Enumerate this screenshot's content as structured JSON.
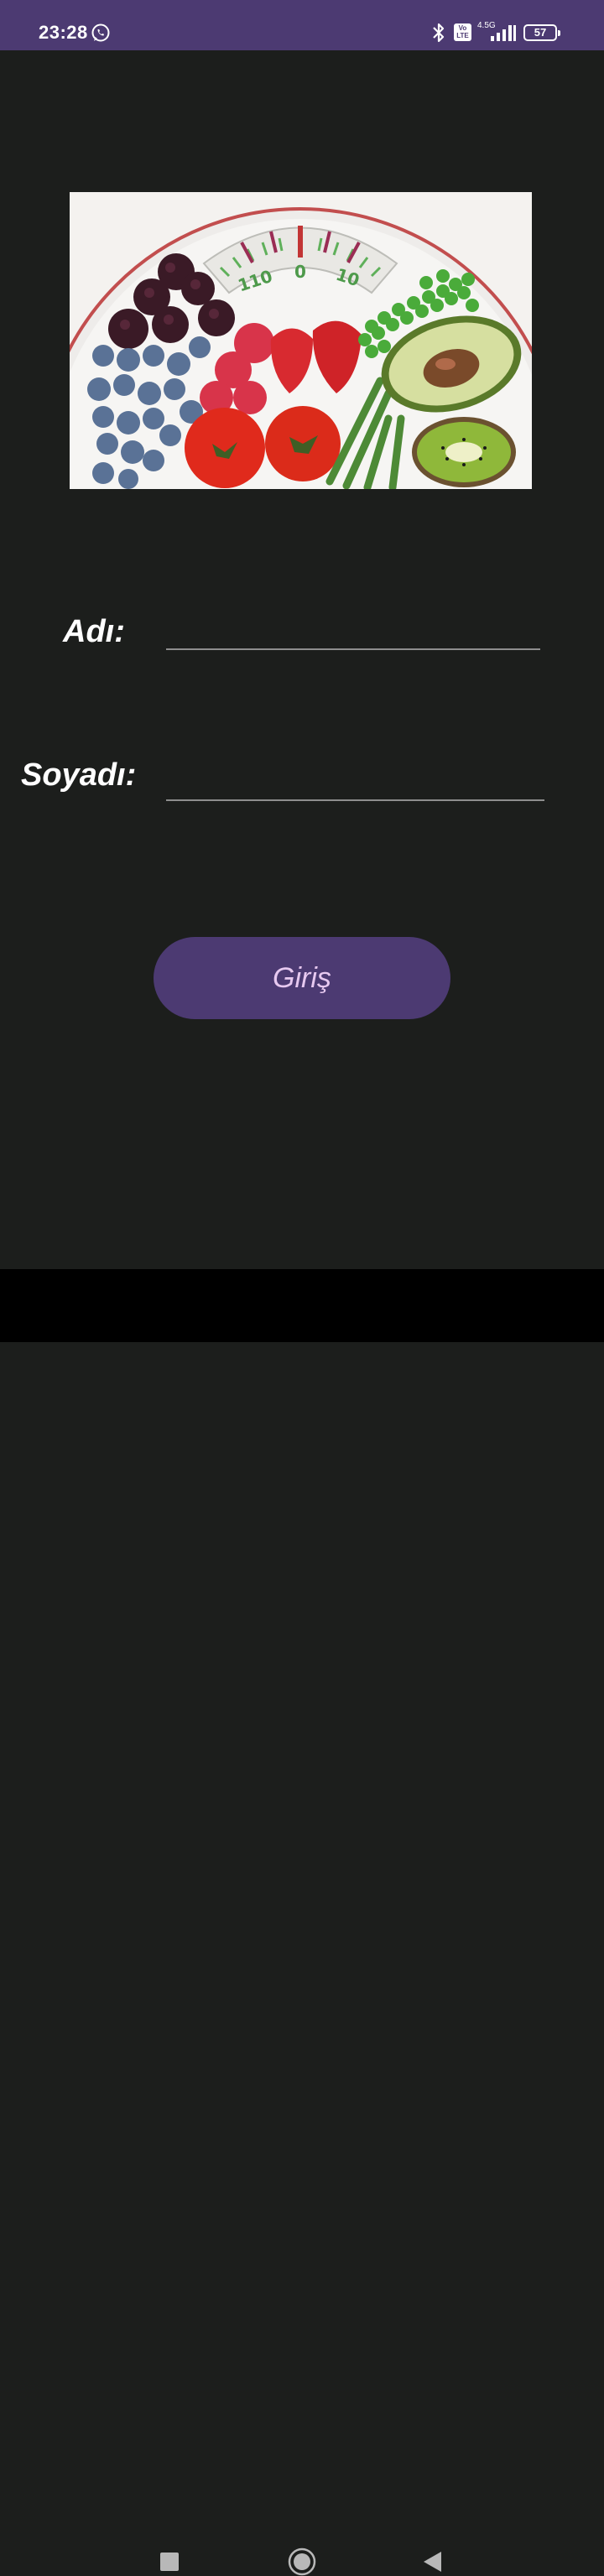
{
  "status_bar": {
    "time": "23:28",
    "volte": "Vo LTE",
    "network": "4.5G",
    "battery": "57"
  },
  "hero": {
    "scale_marks": [
      "110",
      "0",
      "10"
    ]
  },
  "form": {
    "first_name_label": "Adı:",
    "first_name_value": "",
    "last_name_label": "Soyadı:",
    "last_name_value": ""
  },
  "login_button": {
    "label": "Giriş"
  },
  "nav_bar": {
    "recents": "recents-square-icon",
    "home": "home-circle-icon",
    "back": "back-triangle-icon"
  },
  "colors": {
    "bar": "#4c3a72",
    "background": "#1c1e1c",
    "button_text": "#e7c9f0"
  }
}
